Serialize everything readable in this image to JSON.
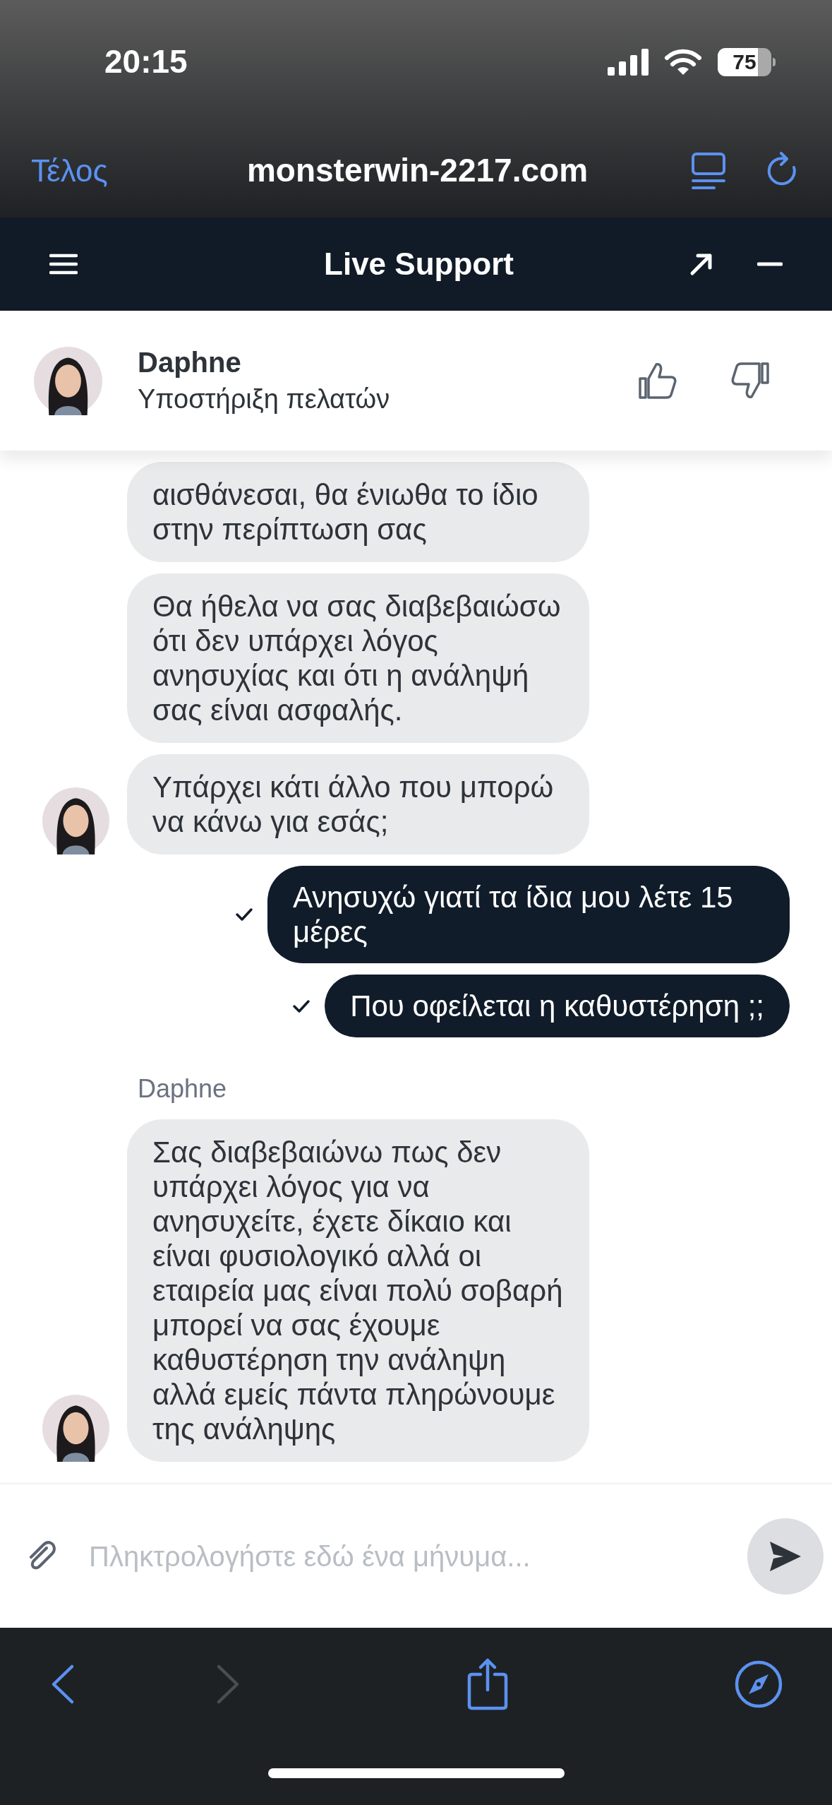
{
  "status_bar": {
    "time": "20:15",
    "battery": "75"
  },
  "browser": {
    "done": "Τέλος",
    "url": "monsterwin-2217.com"
  },
  "header": {
    "title": "Live Support"
  },
  "agent": {
    "name": "Daphne",
    "role": "Υποστήριξη πελατών"
  },
  "messages": [
    {
      "kind": "agent",
      "text": "αισθάνεσαι, θα ένιωθα το ίδιο στην περίπτωση σας",
      "avatar": false
    },
    {
      "kind": "agent",
      "text": "Θα ήθελα να σας διαβεβαιώσω ότι δεν υπάρχει λόγος ανησυχίας και ότι η ανάληψή σας είναι ασφαλής.",
      "avatar": false
    },
    {
      "kind": "agent",
      "text": "Υπάρχει κάτι άλλο που μπορώ να κάνω για εσάς;",
      "avatar": true
    },
    {
      "kind": "user",
      "text": "Ανησυχώ γιατί τα ίδια μου λέτε 15 μέρες",
      "delivered": true
    },
    {
      "kind": "user",
      "text": "Που οφείλεται η καθυστέρηση ;;",
      "delivered": true
    },
    {
      "kind": "sender",
      "text": "Daphne"
    },
    {
      "kind": "agent",
      "text": "Σας διαβεβαιώνω πως δεν υπάρχει λόγος για να ανησυχείτε, έχετε δίκαιο και είναι φυσιολογικό αλλά οι εταιρεία μας είναι πολύ σοβαρή μπορεί να σας έχουμε καθυστέρηση την ανάληψη αλλά εμείς πάντα πληρώνουμε της ανάληψης",
      "avatar": true
    }
  ],
  "composer": {
    "placeholder": "Πληκτρολογήστε εδώ ένα μήνυμα..."
  },
  "toolbar": {
    "back_enabled": true,
    "forward_enabled": false
  }
}
